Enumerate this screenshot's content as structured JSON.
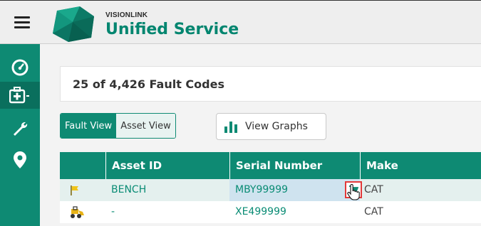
{
  "header": {
    "brand_small": "VISIONLINK",
    "brand_title": "Unified Service"
  },
  "sidebar": {
    "items": [
      {
        "icon": "dashboard-icon",
        "active": false
      },
      {
        "icon": "medical-kit-icon",
        "active": true
      },
      {
        "icon": "wrench-icon",
        "active": false
      },
      {
        "icon": "map-pin-icon",
        "active": false
      }
    ]
  },
  "summary": {
    "count_label": "25 of 4,426 Fault Codes"
  },
  "view_toggle": {
    "fault_view": "Fault View",
    "asset_view": "Asset View",
    "selected": "Fault View"
  },
  "view_graphs": {
    "label": "View Graphs",
    "icon": "bar-chart-icon"
  },
  "table": {
    "columns": [
      "",
      "Asset ID",
      "Serial Number",
      "Make"
    ],
    "rows": [
      {
        "icon": "flag-icon",
        "asset_id": "BENCH",
        "serial": "MBY99999",
        "make": "CAT"
      },
      {
        "icon": "loader-machine-icon",
        "asset_id": "-",
        "serial": "XE499999",
        "make": "CAT"
      }
    ]
  },
  "colors": {
    "brand_green": "#0e8a73",
    "highlight_red": "#e23a3a"
  }
}
